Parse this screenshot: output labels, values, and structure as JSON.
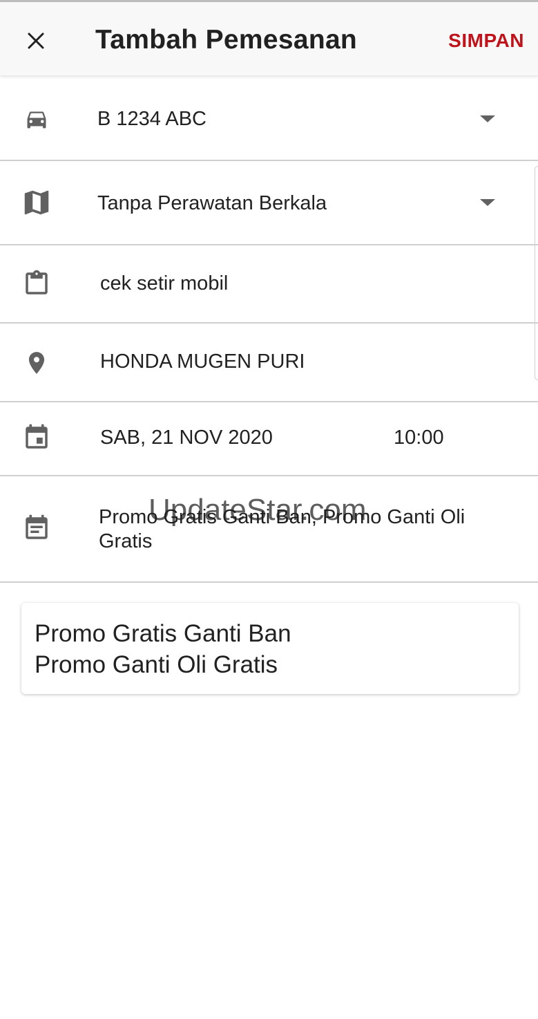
{
  "appbar": {
    "title": "Tambah Pemesanan",
    "save_label": "SIMPAN",
    "close_icon": "close-icon",
    "save_color": "#c0121b"
  },
  "form": {
    "vehicle": {
      "icon": "car-icon",
      "value": "B 1234 ABC"
    },
    "maintenance": {
      "icon": "map-icon",
      "value": "Tanpa Perawatan Berkala"
    },
    "complaint": {
      "icon": "clipboard-icon",
      "value": "cek setir mobil"
    },
    "location": {
      "icon": "location-pin-icon",
      "value": "HONDA MUGEN PURI"
    },
    "schedule": {
      "icon": "calendar-icon",
      "date": "SAB, 21 NOV 2020",
      "time": "10:00"
    },
    "promo": {
      "icon": "event-note-icon",
      "line1": "Promo Gratis Ganti Ban, Promo Ganti Oli",
      "line2": "Gratis"
    }
  },
  "promo_card": {
    "items": [
      "Promo Gratis Ganti Ban",
      "Promo Ganti Oli Gratis"
    ]
  },
  "watermark": "UpdateStar.com"
}
